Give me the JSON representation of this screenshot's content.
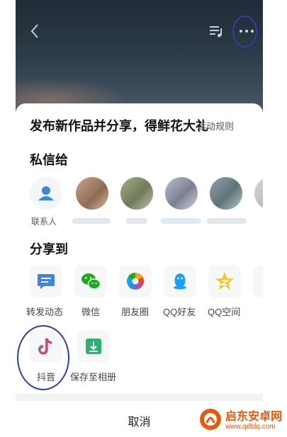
{
  "topbar": {
    "back_icon": "chevron-left-icon",
    "playlist_icon": "playlist-music-icon",
    "more_icon": "more-dots-icon"
  },
  "sheet": {
    "promo_title": "发布新作品并分享，得鲜花大礼",
    "rules_link": "活动规则",
    "private_section_title": "私信给",
    "contacts": [
      {
        "label": "联系人",
        "icon": "person-icon"
      },
      {
        "label": "",
        "icon": "avatar"
      },
      {
        "label": "",
        "icon": "avatar"
      },
      {
        "label": "",
        "icon": "avatar"
      },
      {
        "label": "",
        "icon": "avatar"
      }
    ],
    "share_section_title": "分享到",
    "share_row1": [
      {
        "label": "转发动态",
        "icon": "message-square-icon",
        "color": "#3a86e0"
      },
      {
        "label": "微信",
        "icon": "wechat-icon",
        "color": "#1aad19"
      },
      {
        "label": "朋友圈",
        "icon": "moments-aperture-icon",
        "color": "#f4a21b"
      },
      {
        "label": "QQ好友",
        "icon": "qq-penguin-icon",
        "color": "#1ba1f2"
      },
      {
        "label": "QQ空间",
        "icon": "qzone-star-icon",
        "color": "#f6c42a"
      }
    ],
    "share_row2": [
      {
        "label": "抖音",
        "icon": "douyin-note-icon",
        "color": "#ff2c55"
      },
      {
        "label": "保存至相册",
        "icon": "save-download-icon",
        "color": "#2ab36c"
      }
    ]
  },
  "cancel_label": "取消",
  "watermark": {
    "name": "启东安卓网",
    "url": "www.qdtdq.com"
  },
  "colors": {
    "annotation_ring": "#2e3ea8",
    "sheet_bg": "#ffffff",
    "tile_bg": "#f6f7f9"
  }
}
